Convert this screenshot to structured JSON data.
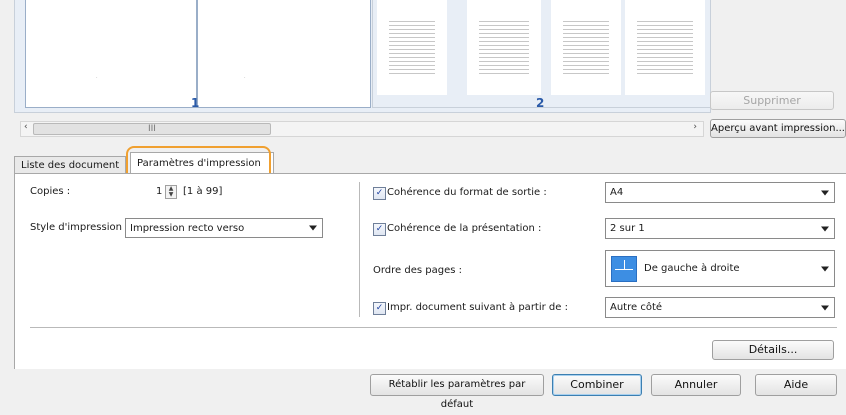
{
  "preview": {
    "page_numbers": [
      "1",
      "2"
    ],
    "delete_button": "Supprimer",
    "print_preview_button": "Aperçu avant impression...",
    "scroll_left": "‹",
    "scroll_right": "›",
    "scroll_grip": "III"
  },
  "tabs": [
    {
      "label": "Liste des document",
      "active": false
    },
    {
      "label": "Paramètres d'impression",
      "active": true
    }
  ],
  "settings": {
    "copies_label": "Copies :",
    "copies_value": "1",
    "copies_range": "[1 à 99]",
    "print_style_label": "Style d'impression :",
    "print_style_value": "Impression recto verso",
    "output_format_label": "Cohérence du format de sortie :",
    "output_format_checked": true,
    "output_format_value": "A4",
    "layout_label": "Cohérence de la présentation :",
    "layout_checked": true,
    "layout_value": "2 sur 1",
    "page_order_label": "Ordre des pages :",
    "page_order_value": "De gauche à droite",
    "next_doc_label": "Impr. document suivant à partir de :",
    "next_doc_checked": true,
    "next_doc_value": "Autre côté",
    "details_button": "Détails..."
  },
  "footer": {
    "restore_defaults_button": "Rétablir les paramètres par défaut",
    "combine_button": "Combiner",
    "cancel_button": "Annuler",
    "help_button": "Aide"
  },
  "colors": {
    "highlight": "#f0a030",
    "accent": "#3d8ee3"
  }
}
